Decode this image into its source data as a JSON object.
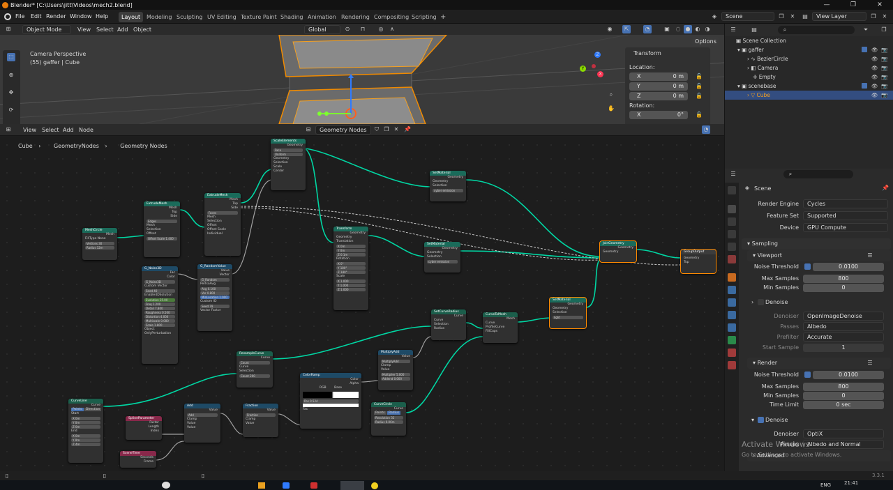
{
  "window": {
    "title": "Blender* [C:\\Users\\jitt\\Videos\\mech2.blend]",
    "controls": [
      "—",
      "❐",
      "✕"
    ]
  },
  "menubar": {
    "menus": [
      "File",
      "Edit",
      "Render",
      "Window",
      "Help"
    ],
    "workspaces": [
      "Layout",
      "Modeling",
      "Sculpting",
      "UV Editing",
      "Texture Paint",
      "Shading",
      "Animation",
      "Rendering",
      "Compositing",
      "Scripting"
    ],
    "add_workspace": "+",
    "scene": "Scene",
    "view_layer": "View Layer"
  },
  "viewport": {
    "mode": "Object Mode",
    "menus": [
      "View",
      "Select",
      "Add",
      "Object"
    ],
    "orientation": "Global",
    "options_label": "Options",
    "camera_label": "Camera Perspective",
    "object_label": "(55) gaffer | Cube",
    "transform": {
      "title": "Transform",
      "location_label": "Location:",
      "rotation_label": "Rotation:",
      "location": [
        {
          "axis": "X",
          "value": "0 m"
        },
        {
          "axis": "Y",
          "value": "0 m"
        },
        {
          "axis": "Z",
          "value": "0 m"
        }
      ],
      "rotation": [
        {
          "axis": "X",
          "value": "0°"
        }
      ]
    },
    "gizmo_axes": [
      "X",
      "Y",
      "Z"
    ]
  },
  "node_editor": {
    "menus": [
      "View",
      "Select",
      "Add",
      "Node"
    ],
    "node_group": "Geometry Nodes",
    "breadcrumb": [
      "Cube",
      "GeometryNodes",
      "Geometry Nodes"
    ],
    "breadcrumb_sep": "›",
    "nodes": {
      "scale_elements": {
        "title": "ScaleElements",
        "rows": [
          "Geometry",
          "Face",
          "Uniform",
          "Geometry",
          "Selection",
          "Scale",
          "Center"
        ]
      },
      "set_material_1": {
        "title": "SetMaterial",
        "rows": [
          "Geometry",
          "Geometry",
          "Selection",
          "cyber emission"
        ]
      },
      "extrude_mesh_1": {
        "title": "ExtrudeMesh",
        "rows": [
          "Mesh",
          "Top",
          "Side",
          "Edges",
          "Mesh",
          "Selection",
          "Offset",
          "Offset Scale"
        ],
        "offset_scale": "1.400"
      },
      "extrude_mesh_2": {
        "title": "ExtrudeMesh",
        "rows": [
          "Mesh",
          "Top",
          "Side",
          "Faces",
          "Mesh",
          "Selection",
          "Offset",
          "Offset Scale",
          "Individual"
        ]
      },
      "mesh_circle": {
        "title": "MeshCircle",
        "rows": [
          "Mesh",
          "N-Gon",
          "Vertices",
          "Radius"
        ],
        "fill_type_label": "FillType",
        "fill_type": "None",
        "vertices": "30",
        "radius": "12m"
      },
      "noise_texture": {
        "title": "G_Noise3D",
        "rows": [
          "Fac",
          "Color",
          "G_Noise3D",
          "Custom Vector",
          "Seed",
          "Enable4DSolution",
          "Evolution",
          "Freq",
          "Detail",
          "Roughness",
          "Distortion",
          "Multiscale",
          "Scale",
          "Object",
          "OnlyPerturbation"
        ],
        "values": [
          "40",
          "25.00",
          "1.200",
          "7.800",
          "0.500",
          "4.000",
          "0.000",
          "1.800"
        ]
      },
      "random_value": {
        "title": "G_RandomValue",
        "rows": [
          "Value",
          "Vector",
          "G_Random",
          "PerIsoAvg",
          "Avg",
          "Var",
          "MinLocation",
          "Custom ID",
          "Seed",
          "Vector Factor"
        ],
        "values": [
          "0.100",
          "0.800",
          "1.000",
          "78"
        ]
      },
      "transform": {
        "title": "Transform",
        "rows": [
          "Geometry",
          "Geometry",
          "Translation",
          "X",
          "Y",
          "Z",
          "Rotation",
          "X",
          "Y",
          "Z",
          "Scale",
          "X",
          "Y",
          "Z"
        ],
        "values": [
          "0m",
          "0m",
          "0.1m",
          "0°",
          "180°",
          "180°",
          "1.000",
          "1.000",
          "1.000"
        ]
      },
      "set_material_2": {
        "title": "SetMaterial",
        "rows": [
          "Geometry",
          "Geometry",
          "Selection",
          "cyber emission"
        ]
      },
      "join_geometry": {
        "title": "JoinGeometry",
        "rows": [
          "Geometry",
          "Geometry"
        ]
      },
      "group_output": {
        "title": "GroupOutput",
        "rows": [
          "Geometry",
          "Top"
        ]
      },
      "set_curve_radius": {
        "title": "SetCurveRadius",
        "rows": [
          "Curve",
          "Curve",
          "Selection",
          "Radius"
        ]
      },
      "curve_to_mesh": {
        "title": "CurveToMesh",
        "rows": [
          "Mesh",
          "Curve",
          "ProfileCurve",
          "FillCaps"
        ]
      },
      "set_material_3": {
        "title": "SetMaterial",
        "rows": [
          "Geometry",
          "Geometry",
          "Selection",
          "light"
        ]
      },
      "resample_curve": {
        "title": "ResampleCurve",
        "rows": [
          "Curve",
          "Count",
          "Curve",
          "Selection",
          "Count"
        ],
        "count": "200"
      },
      "multiply_add": {
        "title": "MultiplyAdd",
        "rows": [
          "Value",
          "MultiplyAdd",
          "Clamp",
          "Value",
          "Multiplier",
          "Addend"
        ],
        "values": [
          "5.000",
          "0.000"
        ]
      },
      "color_ramp": {
        "title": "ColorRamp",
        "rows": [
          "Color",
          "Alpha",
          "RGB",
          "Base",
          "Pos",
          "Fac"
        ],
        "pos": "0.524"
      },
      "curve_line": {
        "title": "CurveLine",
        "rows": [
          "Curve",
          "Points",
          "Direction",
          "Start",
          "X",
          "Y",
          "Z",
          "End",
          "X",
          "Y",
          "Z"
        ],
        "values": [
          "0m",
          "0m",
          "0m",
          "0m",
          "0m",
          "4m"
        ]
      },
      "spline_parameter": {
        "title": "SplineParameter",
        "rows": [
          "Factor",
          "Length",
          "Index"
        ]
      },
      "add": {
        "title": "Add",
        "rows": [
          "Value",
          "Add",
          "Clamp",
          "Value",
          "Value"
        ]
      },
      "fraction": {
        "title": "Fraction",
        "rows": [
          "Value",
          "Fraction",
          "Clamp",
          "Value"
        ]
      },
      "curve_circle": {
        "title": "CurveCircle",
        "rows": [
          "Curve",
          "Points",
          "Radius",
          "Resolution",
          "Radius"
        ],
        "values": [
          "32",
          "0.06m"
        ]
      },
      "scene_time": {
        "title": "SceneTime",
        "rows": [
          "Seconds",
          "Frame"
        ]
      }
    }
  },
  "outliner": {
    "search_placeholder": "",
    "items": [
      {
        "label": "Scene Collection",
        "indent": 0
      },
      {
        "label": "gaffer",
        "indent": 1
      },
      {
        "label": "BezierCircle",
        "indent": 2
      },
      {
        "label": "Camera",
        "indent": 2
      },
      {
        "label": "Empty",
        "indent": 2
      },
      {
        "label": "scenebase",
        "indent": 1
      },
      {
        "label": "Cube",
        "indent": 2,
        "selected": true
      }
    ]
  },
  "properties": {
    "scene_label": "Scene",
    "render_engine": {
      "label": "Render Engine",
      "value": "Cycles"
    },
    "feature_set": {
      "label": "Feature Set",
      "value": "Supported"
    },
    "device": {
      "label": "Device",
      "value": "GPU Compute"
    },
    "sampling": "Sampling",
    "viewport": {
      "title": "Viewport",
      "noise_threshold": {
        "label": "Noise Threshold",
        "value": "0.0100"
      },
      "max_samples": {
        "label": "Max Samples",
        "value": "800"
      },
      "min_samples": {
        "label": "Min Samples",
        "value": "0"
      },
      "denoise": "Denoise",
      "denoiser": {
        "label": "Denoiser",
        "value": "OpenImageDenoise"
      },
      "passes": {
        "label": "Passes",
        "value": "Albedo"
      },
      "prefilter": {
        "label": "Prefilter",
        "value": "Accurate"
      },
      "start_sample": {
        "label": "Start Sample",
        "value": "1"
      }
    },
    "render": {
      "title": "Render",
      "noise_threshold": {
        "label": "Noise Threshold",
        "value": "0.0100"
      },
      "max_samples": {
        "label": "Max Samples",
        "value": "800"
      },
      "min_samples": {
        "label": "Min Samples",
        "value": "0"
      },
      "time_limit": {
        "label": "Time Limit",
        "value": "0 sec"
      },
      "denoise": "Denoise",
      "denoiser": {
        "label": "Denoiser",
        "value": "OptiX"
      },
      "passes": {
        "label": "Passes",
        "value": "Albedo and Normal"
      }
    },
    "advanced": "Advanced"
  },
  "watermark": {
    "line1": "Activate Windows",
    "line2": "Go to Settings to activate Windows."
  },
  "statusbar": {
    "version": "3.3.1"
  },
  "taskbar": {
    "lang": "ENG",
    "time": "21:41"
  }
}
